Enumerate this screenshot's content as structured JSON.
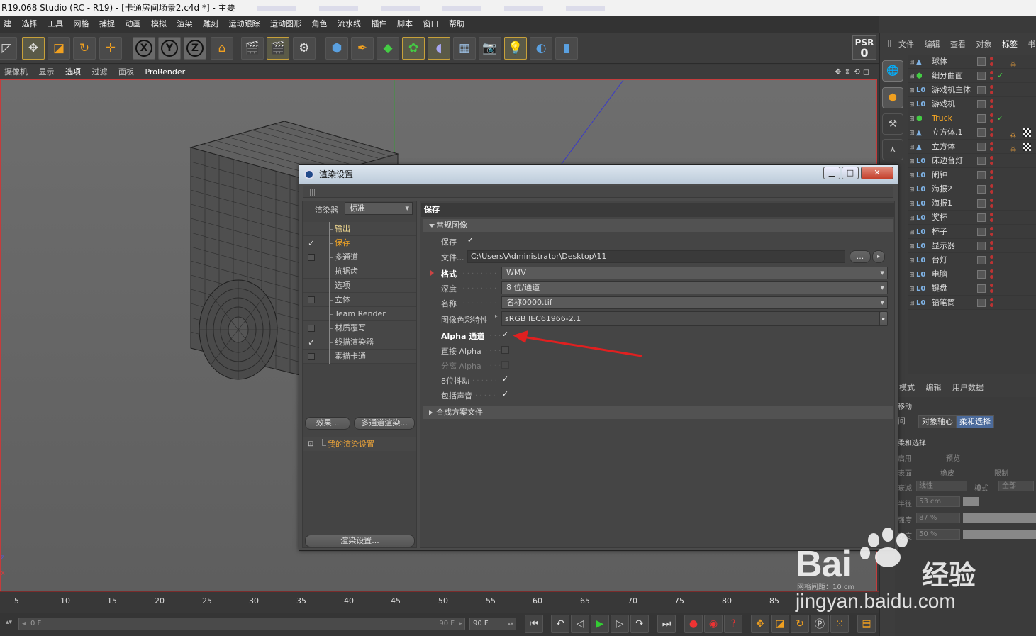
{
  "window": {
    "title": "R19.068 Studio (RC - R19) - [卡通房间场景2.c4d *] - 主要"
  },
  "menubar": [
    "建",
    "选择",
    "工具",
    "网格",
    "捕捉",
    "动画",
    "模拟",
    "渲染",
    "雕刻",
    "运动跟踪",
    "运动图形",
    "角色",
    "流水线",
    "插件",
    "脚本",
    "窗口",
    "帮助"
  ],
  "psr": {
    "label": "PSR",
    "value": "0"
  },
  "viewport_menu": [
    "摄像机",
    "显示",
    "选项",
    "过滤",
    "面板",
    "ProRender"
  ],
  "object_manager": {
    "tabs": [
      "文件",
      "编辑",
      "查看",
      "对象",
      "标签",
      "书签"
    ],
    "objects": [
      {
        "name": "球体",
        "icon": "cone-icon",
        "tag": true
      },
      {
        "name": "细分曲面",
        "icon": "subdivision-icon",
        "check": true
      },
      {
        "name": "游戏机主体",
        "icon": "null-icon"
      },
      {
        "name": "游戏机",
        "icon": "null-icon"
      },
      {
        "name": "Truck",
        "icon": "subdivision-icon",
        "check": true,
        "highlight": true
      },
      {
        "name": "立方体.1",
        "icon": "cone-icon",
        "tag": true,
        "checker": true
      },
      {
        "name": "立方体",
        "icon": "cone-icon",
        "tag": true,
        "checker": true
      },
      {
        "name": "床边台灯",
        "icon": "null-icon"
      },
      {
        "name": "闹钟",
        "icon": "null-icon"
      },
      {
        "name": "海报2",
        "icon": "null-icon"
      },
      {
        "name": "海报1",
        "icon": "null-icon"
      },
      {
        "name": "奖杯",
        "icon": "null-icon"
      },
      {
        "name": "杯子",
        "icon": "null-icon"
      },
      {
        "name": "显示器",
        "icon": "null-icon"
      },
      {
        "name": "台灯",
        "icon": "null-icon"
      },
      {
        "name": "电脑",
        "icon": "null-icon"
      },
      {
        "name": "键盘",
        "icon": "null-icon"
      },
      {
        "name": "铅笔筒",
        "icon": "null-icon"
      }
    ]
  },
  "attributes": {
    "tabs": [
      "模式",
      "编辑",
      "用户数据"
    ],
    "section": "移动",
    "buttons": [
      "对象轴心",
      "柔和选择"
    ],
    "subsection": "柔和选择",
    "rows": [
      "启用",
      "预览",
      "表面",
      "橡皮",
      "限制",
      "衰减",
      "线性",
      "模式",
      "全部",
      "半径",
      "53 cm",
      "强度",
      "87 %",
      "宽度",
      "50 %"
    ]
  },
  "timeline": {
    "ticks": [
      "5",
      "10",
      "15",
      "20",
      "25",
      "30",
      "35",
      "40",
      "45",
      "50",
      "55",
      "60",
      "65",
      "70",
      "75",
      "80",
      "85"
    ],
    "start": "0 F",
    "end": "90 F",
    "end_field": "90 F",
    "grid_label": "网格间距：10 cm"
  },
  "dialog": {
    "title": "渲染设置",
    "renderer_label": "渲染器",
    "renderer_value": "标准",
    "nav": [
      {
        "label": "输出",
        "checkbox": false,
        "has_cb": false
      },
      {
        "label": "保存",
        "checkbox": true,
        "has_cb": true,
        "selected": true
      },
      {
        "label": "多通道",
        "checkbox": false,
        "has_cb": true
      },
      {
        "label": "抗锯齿",
        "checkbox": false,
        "has_cb": false
      },
      {
        "label": "选项",
        "checkbox": false,
        "has_cb": false
      },
      {
        "label": "立体",
        "checkbox": false,
        "has_cb": true
      },
      {
        "label": "Team Render",
        "checkbox": false,
        "has_cb": false
      },
      {
        "label": "材质覆写",
        "checkbox": false,
        "has_cb": true
      },
      {
        "label": "线描渲染器",
        "checkbox": true,
        "has_cb": true
      },
      {
        "label": "素描卡通",
        "checkbox": false,
        "has_cb": true
      }
    ],
    "effects_button": "效果...",
    "multipass_button": "多通道渲染...",
    "my_render_setting": "我的渲染设置",
    "render_settings_button": "渲染设置...",
    "panel_title": "保存",
    "section_regular": "常规图像",
    "section_compositing": "合成方案文件",
    "fields": {
      "save_label": "保存",
      "file_label": "文件...",
      "file_path": "C:\\Users\\Administrator\\Desktop\\11",
      "browse_button": "...",
      "format_label": "格式",
      "format_value": "WMV",
      "depth_label": "深度",
      "depth_value": "8 位/通道",
      "name_label": "名称",
      "name_value": "名称0000.tif",
      "profile_label": "图像色彩特性",
      "profile_value": "sRGB IEC61966-2.1",
      "alpha_label": "Alpha 通道",
      "straight_alpha_label": "直接 Alpha",
      "separate_alpha_label": "分离 Alpha",
      "dither_label": "8位抖动",
      "sound_label": "包括声音"
    },
    "checks": {
      "save": true,
      "alpha": true,
      "straight_alpha": false,
      "separate_alpha": false,
      "dither": true,
      "sound": true
    }
  },
  "watermark": {
    "brand": "Bai",
    "brand_cn": "经验",
    "url": "jingyan.baidu.com"
  },
  "colors": {
    "accent": "#f5a623",
    "selection": "#4c6b9b",
    "arrow": "#e02020"
  }
}
